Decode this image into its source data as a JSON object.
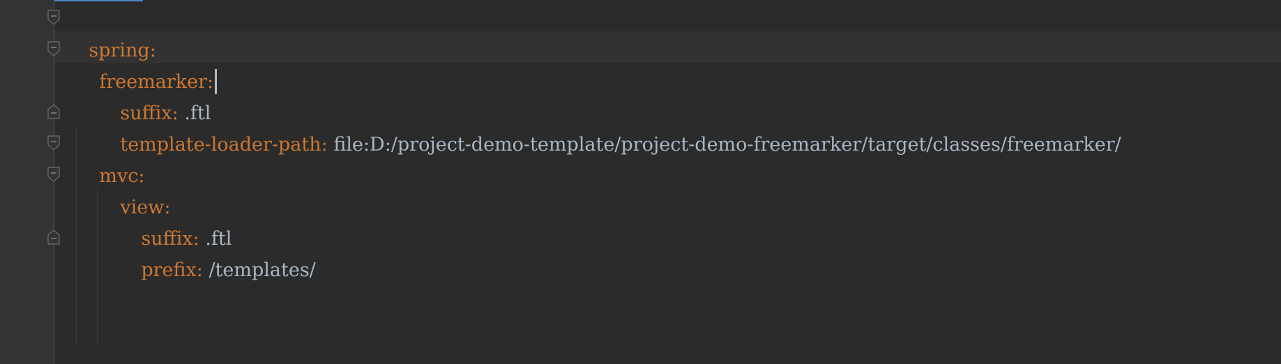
{
  "editor": {
    "lines": [
      {
        "key": "spring:",
        "value": ""
      },
      {
        "key": "freemarker:",
        "value": ""
      },
      {
        "key": "suffix:",
        "value": " .ftl"
      },
      {
        "key": "template-loader-path:",
        "value": " file:D:/project-demo-template/project-demo-freemarker/target/classes/freemarker/"
      },
      {
        "key": "mvc:",
        "value": ""
      },
      {
        "key": "view:",
        "value": ""
      },
      {
        "key": "suffix:",
        "value": " .ftl"
      },
      {
        "key": "prefix:",
        "value": " /templates/"
      }
    ]
  },
  "colors": {
    "background": "#2b2b2b",
    "gutter": "#313335",
    "key": "#cc7832",
    "value": "#a9b7c6",
    "tab_indicator": "#4a88c7"
  },
  "icons": {
    "fold_open": "fold-start-icon",
    "fold_close": "fold-end-icon"
  }
}
